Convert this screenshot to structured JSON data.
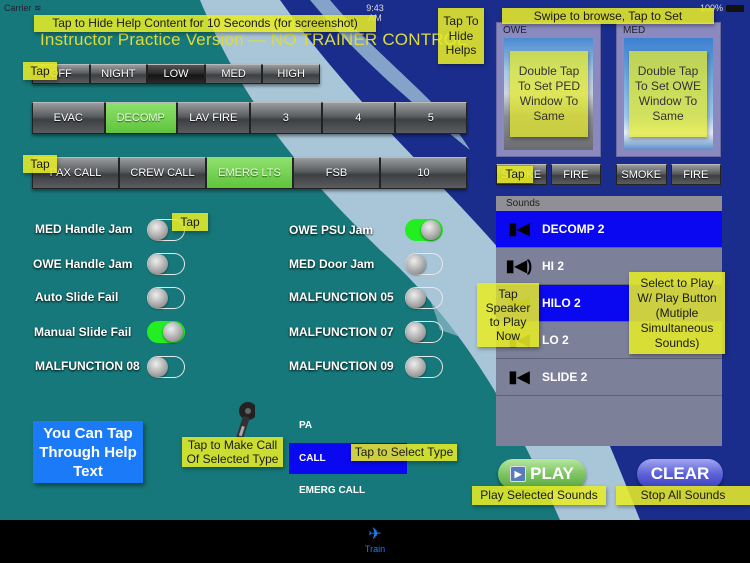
{
  "status_bar": {
    "carrier": "Carrier",
    "time": "9:43 AM",
    "battery": "100%"
  },
  "title": "Instructor Practice Version — NO TRAINER CONTROL",
  "help": {
    "hide_for_screenshot": "Tap to Hide Help Content for 10 Seconds (for screenshot)",
    "hide_helps": "Tap To Hide Helps",
    "swipe_browse": "Swipe to browse, Tap to Set",
    "tap": "Tap",
    "owe_double_tap": "Double Tap To Set PED Window To Same",
    "med_double_tap": "Double Tap To Set OWE Window To Same",
    "tap_speaker": "Tap Speaker to Play Now",
    "select_to_play": "Select to Play W/ Play Button (Mutiple Simultaneous Sounds)",
    "tap_through": "You Can Tap Through Help Text",
    "make_call": "Tap to Make Call Of Selected Type",
    "select_type": "Tap to Select Type",
    "play_selected": "Play Selected Sounds",
    "stop_all": "Stop All Sounds"
  },
  "lighting": {
    "options": [
      "OFF",
      "NIGHT",
      "LOW",
      "MED",
      "HIGH"
    ],
    "selected": "LOW"
  },
  "scenarios": {
    "options": [
      "EVAC",
      "DECOMP",
      "LAV FIRE",
      "3",
      "4",
      "5"
    ],
    "selected": "DECOMP"
  },
  "cabin_events": {
    "options": [
      "PAX CALL",
      "CREW CALL",
      "EMERG LTS",
      "FSB",
      "10"
    ],
    "selected": "EMERG LTS"
  },
  "malfunctions_left": [
    {
      "label": "MED Handle Jam",
      "on": false
    },
    {
      "label": "OWE Handle Jam",
      "on": false
    },
    {
      "label": "Auto Slide Fail",
      "on": false
    },
    {
      "label": "Manual Slide Fail",
      "on": true
    },
    {
      "label": "MALFUNCTION 08",
      "on": false
    }
  ],
  "malfunctions_right": [
    {
      "label": "OWE PSU Jam",
      "on": true
    },
    {
      "label": "MED Door Jam",
      "on": false
    },
    {
      "label": "MALFUNCTION 05",
      "on": false
    },
    {
      "label": "MALFUNCTION 07",
      "on": false
    },
    {
      "label": "MALFUNCTION 09",
      "on": false
    }
  ],
  "windows": [
    {
      "label": "OWE",
      "buttons": [
        "SMOKE",
        "FIRE"
      ]
    },
    {
      "label": "MED",
      "buttons": [
        "SMOKE",
        "FIRE"
      ]
    }
  ],
  "sounds": {
    "header": "Sounds",
    "items": [
      {
        "label": "DECOMP 2",
        "selected": true,
        "playing": false
      },
      {
        "label": "HI 2",
        "selected": false,
        "playing": true
      },
      {
        "label": "HILO 2",
        "selected": true,
        "playing": false
      },
      {
        "label": "LO 2",
        "selected": false,
        "playing": false
      },
      {
        "label": "SLIDE 2",
        "selected": false,
        "playing": false
      }
    ]
  },
  "call_types": {
    "options": [
      "PA",
      "CALL",
      "EMERG CALL"
    ],
    "selected": "CALL"
  },
  "buttons": {
    "play": "PLAY",
    "clear": "CLEAR"
  },
  "tabbar": {
    "train": "Train"
  },
  "colors": {
    "selected_blue": "#0a08f0",
    "toggle_on": "#22ee22",
    "segment_selected": "#6fd04c",
    "help_yellow": "#e6eb28"
  }
}
